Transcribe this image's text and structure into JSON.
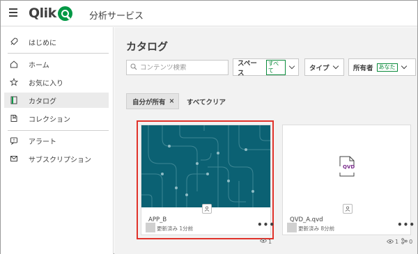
{
  "header": {
    "logo_text": "Qlik",
    "app_title": "分析サービス"
  },
  "sidebar": {
    "items": [
      {
        "label": "はじめに",
        "icon": "rocket-icon"
      },
      {
        "label": "ホーム",
        "icon": "home-icon"
      },
      {
        "label": "お気に入り",
        "icon": "star-icon"
      },
      {
        "label": "カタログ",
        "icon": "catalog-icon",
        "active": true
      },
      {
        "label": "コレクション",
        "icon": "collection-icon"
      },
      {
        "label": "アラート",
        "icon": "alert-icon"
      },
      {
        "label": "サブスクリプション",
        "icon": "mail-icon"
      }
    ]
  },
  "main": {
    "title": "カタログ",
    "search": {
      "placeholder": "コンテンツ検索"
    },
    "filters": [
      {
        "label": "スペース",
        "badge": "すべて"
      },
      {
        "label": "タイプ",
        "badge": ""
      },
      {
        "label": "所有者",
        "badge": "あなた"
      }
    ],
    "chip": {
      "label": "自分が所有",
      "close": "×"
    },
    "clear_all": "すべてクリア"
  },
  "cards": [
    {
      "name": "APP_B",
      "meta": "更新済み 1分前",
      "more": "•••",
      "views": "1",
      "links": ""
    },
    {
      "name": "QVD_A.qvd",
      "meta": "更新済み 8分前",
      "more": "•••",
      "views": "1",
      "links": "0",
      "file_label": "QVD"
    }
  ],
  "colors": {
    "accent_green": "#009845",
    "thumbnail_teal": "#0b6173",
    "highlight_red": "#e0322a"
  }
}
